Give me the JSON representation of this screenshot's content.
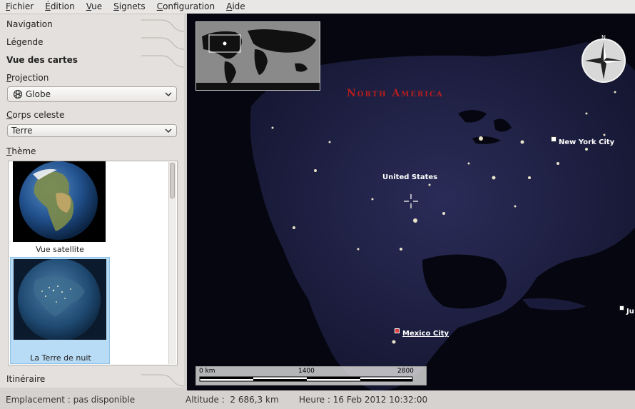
{
  "menu": [
    {
      "u": "F",
      "rest": "ichier"
    },
    {
      "u": "É",
      "rest": "dition"
    },
    {
      "u": "V",
      "rest": "ue"
    },
    {
      "u": "S",
      "rest": "ignets"
    },
    {
      "u": "C",
      "rest": "onfiguration"
    },
    {
      "u": "A",
      "rest": "ide"
    }
  ],
  "sidebar": {
    "navigation": "Navigation",
    "legend": "Légende",
    "map_view": "Vue des cartes",
    "projection_label_u": "P",
    "projection_label_rest": "rojection",
    "projection_value": "Globe",
    "celestial_label_u": "C",
    "celestial_label_rest": "orps celeste",
    "celestial_value": "Terre",
    "theme_label_u": "T",
    "theme_label_rest": "hème",
    "themes": [
      {
        "caption": "Vue satellite"
      },
      {
        "caption": "La Terre de nuit"
      }
    ],
    "route": "Itinéraire"
  },
  "map": {
    "region": "North America",
    "labels": {
      "us": "United States",
      "nyc": "New York City",
      "mexico": "Mexico City",
      "partial": "Ju"
    },
    "scale": {
      "left": "0 km",
      "mid": "1400",
      "right": "2800"
    }
  },
  "status": {
    "location": "Emplacement : pas disponible",
    "altitude": "Altitude :  2 686,3 km",
    "time": "Heure : 16 Feb 2012 10:32:00"
  },
  "colors": {
    "accent_selected": "#b9dcf6",
    "region_label": "#b51d1d"
  }
}
